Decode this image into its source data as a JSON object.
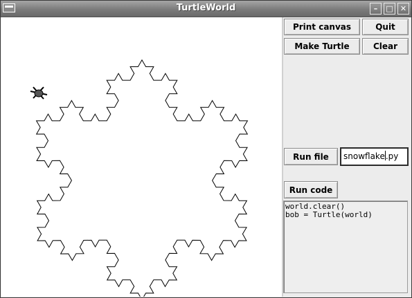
{
  "window": {
    "title": "TurtleWorld",
    "controls": {
      "minimize": "–",
      "maximize": "□",
      "close": "✕"
    }
  },
  "toolbar": {
    "print_canvas": "Print canvas",
    "quit": "Quit",
    "make_turtle": "Make Turtle",
    "clear": "Clear",
    "run_file": "Run file",
    "run_code": "Run code"
  },
  "file_entry": {
    "value_before_caret": "snowflake",
    "value_after_caret": ".py"
  },
  "code_text": "world.clear()\nbob = Turtle(world)",
  "icons": {
    "window_menu": "window-menu-icon",
    "turtle": "turtle-icon"
  },
  "colors": {
    "canvas": "#ffffff",
    "stroke": "#000000",
    "turtle": "#555555"
  }
}
